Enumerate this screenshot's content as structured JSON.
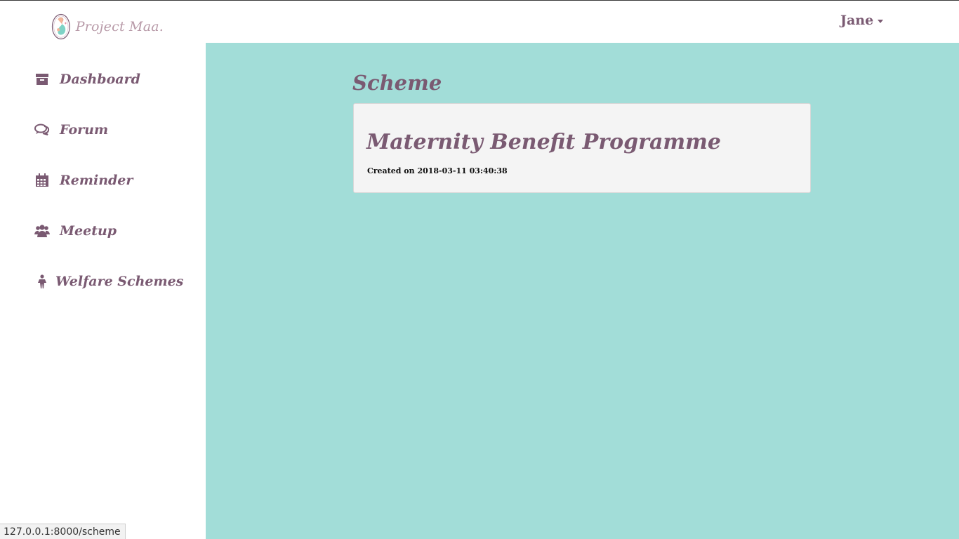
{
  "brand": {
    "logo_text": "Project Maa.",
    "logo_icon": "mother-baby-icon"
  },
  "user": {
    "name": "Jane"
  },
  "sidebar": {
    "items": [
      {
        "label": "Dashboard",
        "icon": "archive-box-icon"
      },
      {
        "label": "Forum",
        "icon": "comments-icon"
      },
      {
        "label": "Reminder",
        "icon": "calendar-icon"
      },
      {
        "label": "Meetup",
        "icon": "users-icon"
      },
      {
        "label": "Welfare Schemes",
        "icon": "child-icon"
      }
    ]
  },
  "main": {
    "title": "Scheme",
    "scheme": {
      "name": "Maternity Benefit Programme",
      "created": "Created on 2018-03-11 03:40:38"
    }
  },
  "status_bar": {
    "url": "127.0.0.1:8000/scheme"
  },
  "colors": {
    "accent": "#7a5a72",
    "background": "#a2ddd8",
    "card": "#f4f4f4"
  }
}
